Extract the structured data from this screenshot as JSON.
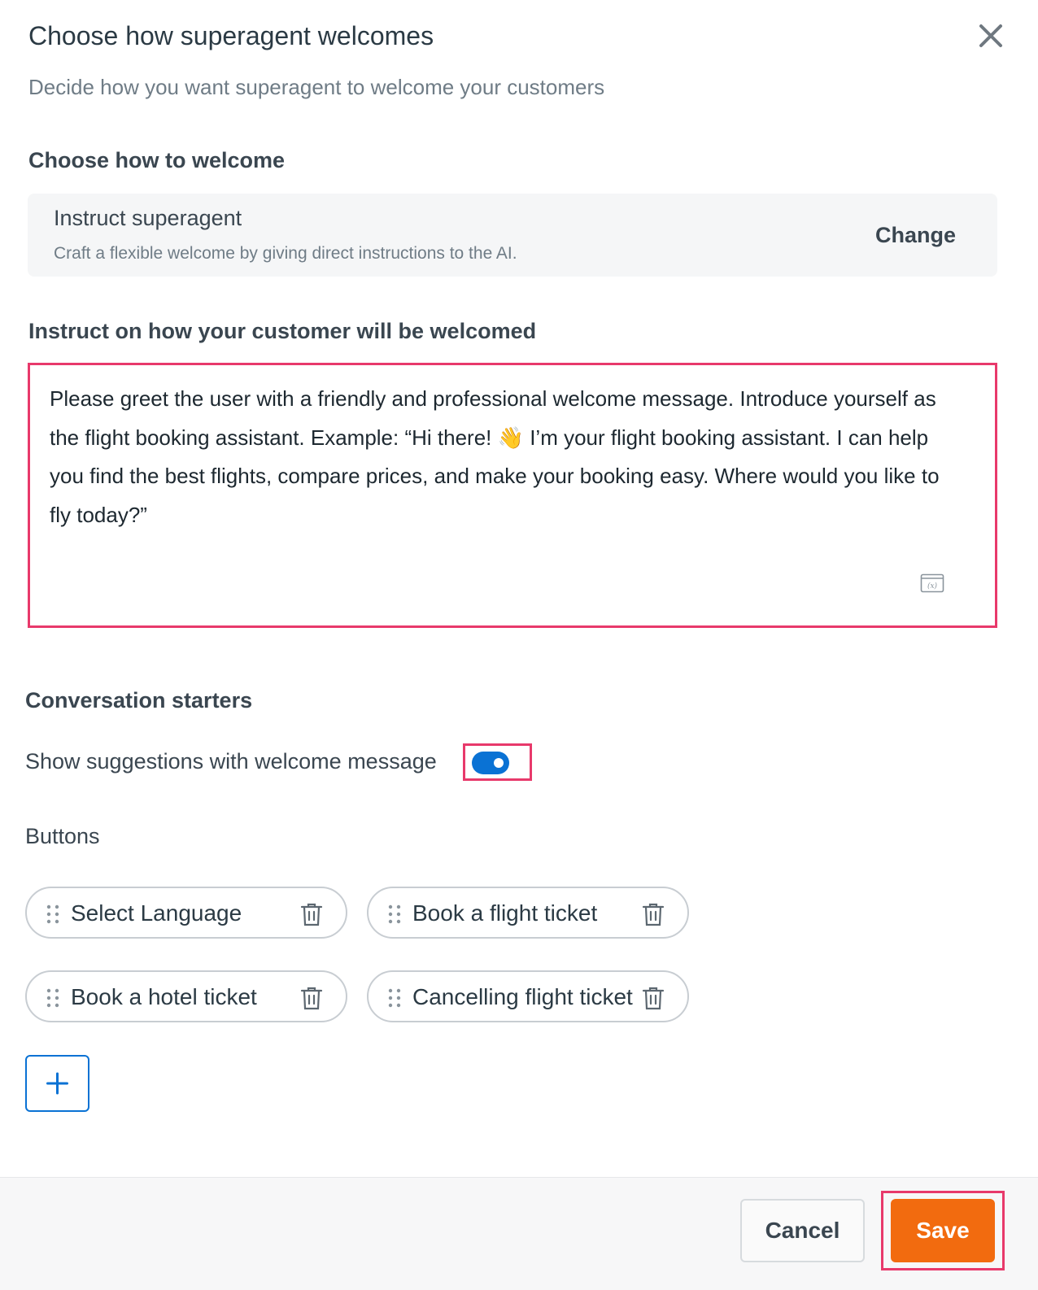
{
  "header": {
    "title": "Choose how superagent welcomes",
    "subtitle": "Decide how you want superagent to welcome your customers"
  },
  "welcome_section": {
    "title": "Choose how to welcome",
    "option_title": "Instruct superagent",
    "option_description": "Craft a flexible welcome by giving direct instructions to the AI.",
    "change_label": "Change"
  },
  "instruct_section": {
    "title": "Instruct on how your customer will be welcomed",
    "text": "Please greet the user with a friendly and professional welcome message. Introduce yourself as the flight booking assistant. Example: “Hi there! 👋 I’m your flight booking assistant. I can help you find the best flights, compare prices, and make your booking easy. Where would you like to fly today?”"
  },
  "conversation_starters": {
    "title": "Conversation starters",
    "toggle_label": "Show suggestions with welcome message",
    "toggle_on": true,
    "buttons_label": "Buttons",
    "buttons": [
      {
        "label": "Select Language"
      },
      {
        "label": "Book a flight ticket"
      },
      {
        "label": "Book a hotel ticket"
      },
      {
        "label": "Cancelling flight ticket"
      }
    ]
  },
  "footer": {
    "cancel_label": "Cancel",
    "save_label": "Save"
  },
  "colors": {
    "accent_blue": "#0a72d4",
    "save_orange": "#f26b0f",
    "highlight_pink": "#e8396b"
  }
}
